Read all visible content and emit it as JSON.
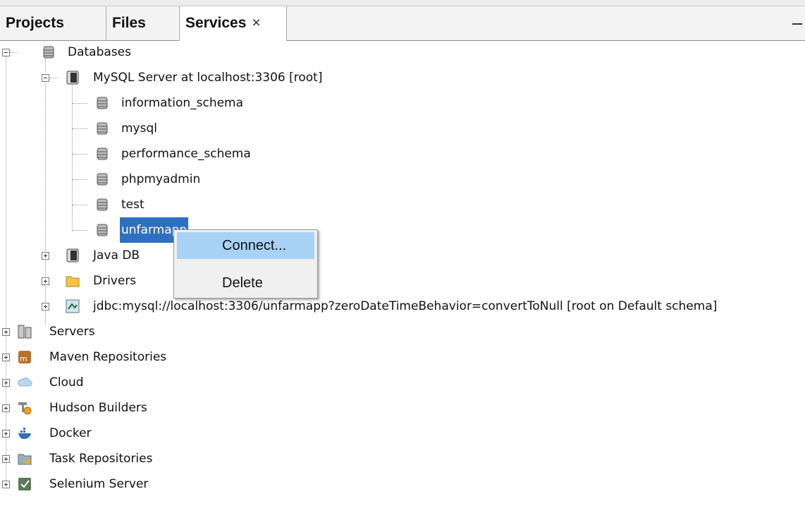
{
  "tabs": {
    "projects": "Projects",
    "files": "Files",
    "services": "Services",
    "close_glyph": "×"
  },
  "tree": {
    "databases": "Databases",
    "mysql_server": "MySQL Server at localhost:3306 [root]",
    "schemas": [
      "information_schema",
      "mysql",
      "performance_schema",
      "phpmyadmin",
      "test",
      "unfarmapp"
    ],
    "java_db": "Java DB",
    "drivers": "Drivers",
    "jdbc": "jdbc:mysql://localhost:3306/unfarmapp?zeroDateTimeBehavior=convertToNull [root on Default schema]",
    "servers": "Servers",
    "maven": "Maven Repositories",
    "cloud": "Cloud",
    "hudson": "Hudson Builders",
    "docker": "Docker",
    "task_repos": "Task Repositories",
    "selenium": "Selenium Server"
  },
  "context_menu": {
    "connect": "Connect...",
    "delete": "Delete"
  },
  "colors": {
    "selection": "#2f6fc0",
    "menu_highlight": "#a8d2f5"
  }
}
